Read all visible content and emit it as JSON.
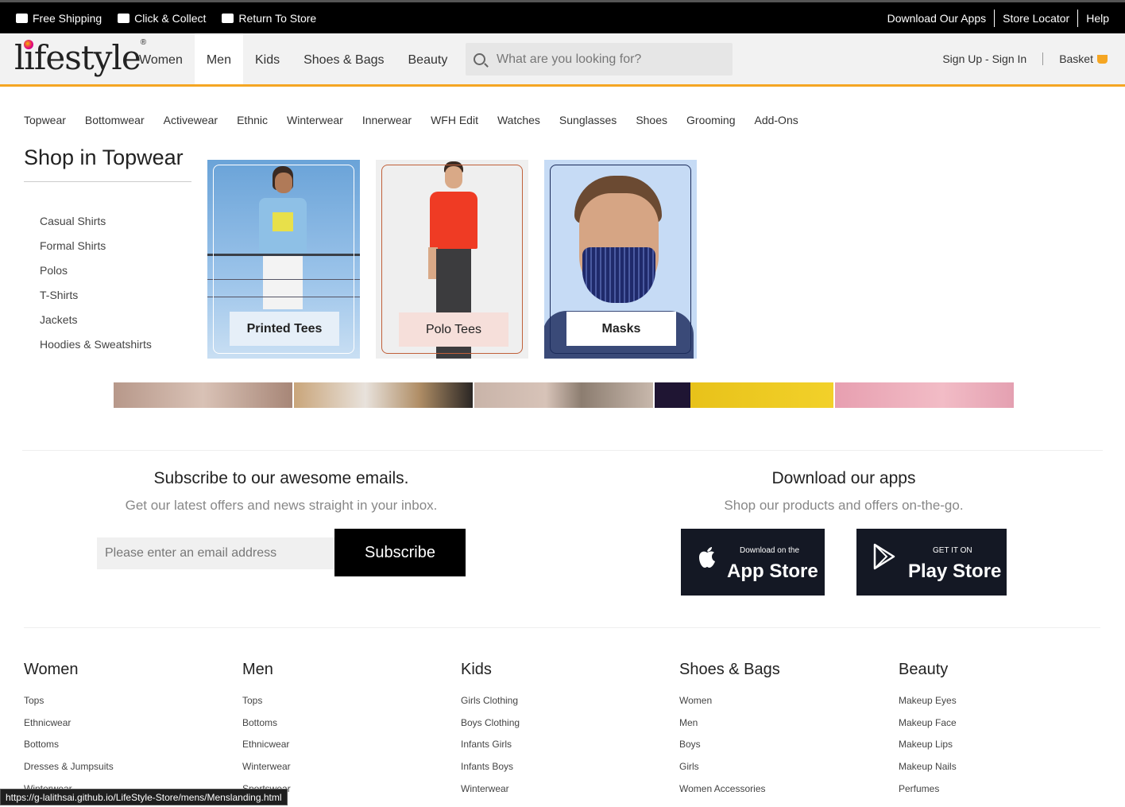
{
  "topbar": {
    "left": [
      {
        "label": "Free Shipping",
        "icon": "truck-icon"
      },
      {
        "label": "Click & Collect",
        "icon": "store-icon"
      },
      {
        "label": "Return To Store",
        "icon": "store-return-icon"
      }
    ],
    "right": [
      "Download Our Apps",
      "Store Locator",
      "Help"
    ]
  },
  "header": {
    "logo": "lifestyle",
    "nav": [
      "Women",
      "Men",
      "Kids",
      "Shoes & Bags",
      "Beauty"
    ],
    "active_nav": "Men",
    "search_placeholder": "What are you looking for?",
    "signin": "Sign Up - Sign In",
    "basket": "Basket"
  },
  "submenu": {
    "items": [
      "Topwear",
      "Bottomwear",
      "Activewear",
      "Ethnic",
      "Winterwear",
      "Innerwear",
      "WFH Edit",
      "Watches",
      "Sunglasses",
      "Shoes",
      "Grooming",
      "Add-Ons"
    ],
    "title": "Shop in Topwear",
    "categories": [
      "Casual Shirts",
      "Formal Shirts",
      "Polos",
      "T-Shirts",
      "Jackets",
      "Hoodies & Sweatshirts"
    ],
    "cards": [
      "Printed Tees",
      "Polo Tees",
      "Masks"
    ]
  },
  "subscribe": {
    "title": "Subscribe to our awesome emails.",
    "text": "Get our latest offers and news straight in your inbox.",
    "placeholder": "Please enter an email address",
    "button": "Subscribe"
  },
  "apps": {
    "title": "Download our apps",
    "text": "Shop our products and offers on-the-go.",
    "appstore_small": "Download on the",
    "appstore_big": "App Store",
    "playstore_small": "GET IT ON",
    "playstore_big": "Play Store"
  },
  "footer": {
    "columns": [
      {
        "title": "Women",
        "links": [
          "Tops",
          "Ethnicwear",
          "Bottoms",
          "Dresses & Jumpsuits",
          "Winterwear"
        ]
      },
      {
        "title": "Men",
        "links": [
          "Tops",
          "Bottoms",
          "Ethnicwear",
          "Winterwear",
          "Sportswear"
        ]
      },
      {
        "title": "Kids",
        "links": [
          "Girls Clothing",
          "Boys Clothing",
          "Infants Girls",
          "Infants Boys",
          "Winterwear"
        ]
      },
      {
        "title": "Shoes & Bags",
        "links": [
          "Women",
          "Men",
          "Boys",
          "Girls",
          "Women Accessories"
        ]
      },
      {
        "title": "Beauty",
        "links": [
          "Makeup Eyes",
          "Makeup Face",
          "Makeup Lips",
          "Makeup Nails",
          "Perfumes"
        ]
      }
    ]
  },
  "statusbar": "https://g-lalithsai.github.io/LifeStyle-Store/mens/Menslanding.html",
  "colors": {
    "accent": "#f5a623",
    "topbar": "#000000",
    "store_button": "#141824"
  }
}
